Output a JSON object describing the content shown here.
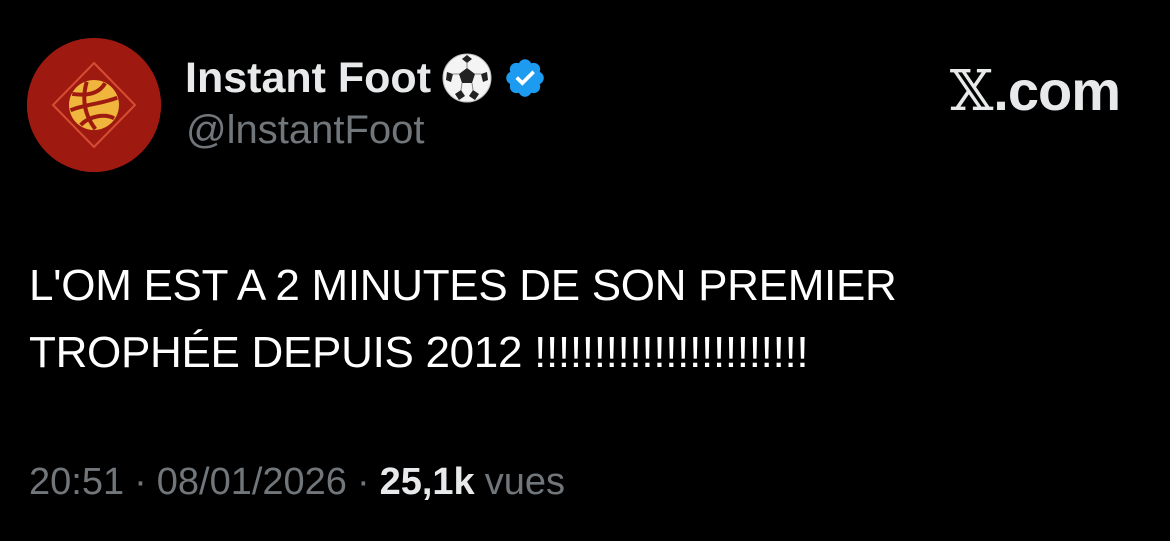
{
  "author": {
    "display_name": "Instant Foot",
    "name_emoji": "soccer-ball-icon",
    "verified_badge": "verified-badge-icon",
    "handle": "@lnstantFoot",
    "avatar_icon": "volleyball-logo-icon"
  },
  "brand": {
    "x_mark": "𝕏",
    "label": ".com"
  },
  "tweet": {
    "text": "L'OM EST A 2 MINUTES DE SON PREMIER\nTROPHÉE DEPUIS 2012 !!!!!!!!!!!!!!!!!!!!!!!"
  },
  "meta": {
    "time": "20:51",
    "separator": "·",
    "date": "08/01/2026",
    "views_count": "25,1k",
    "views_label": "vues"
  },
  "colors": {
    "background": "#000000",
    "text_primary": "#e7e9ea",
    "text_secondary": "#71767b",
    "verified_blue": "#1d9bf0",
    "avatar_red": "#9e1a10",
    "logo_gold": "#f0b53d"
  }
}
